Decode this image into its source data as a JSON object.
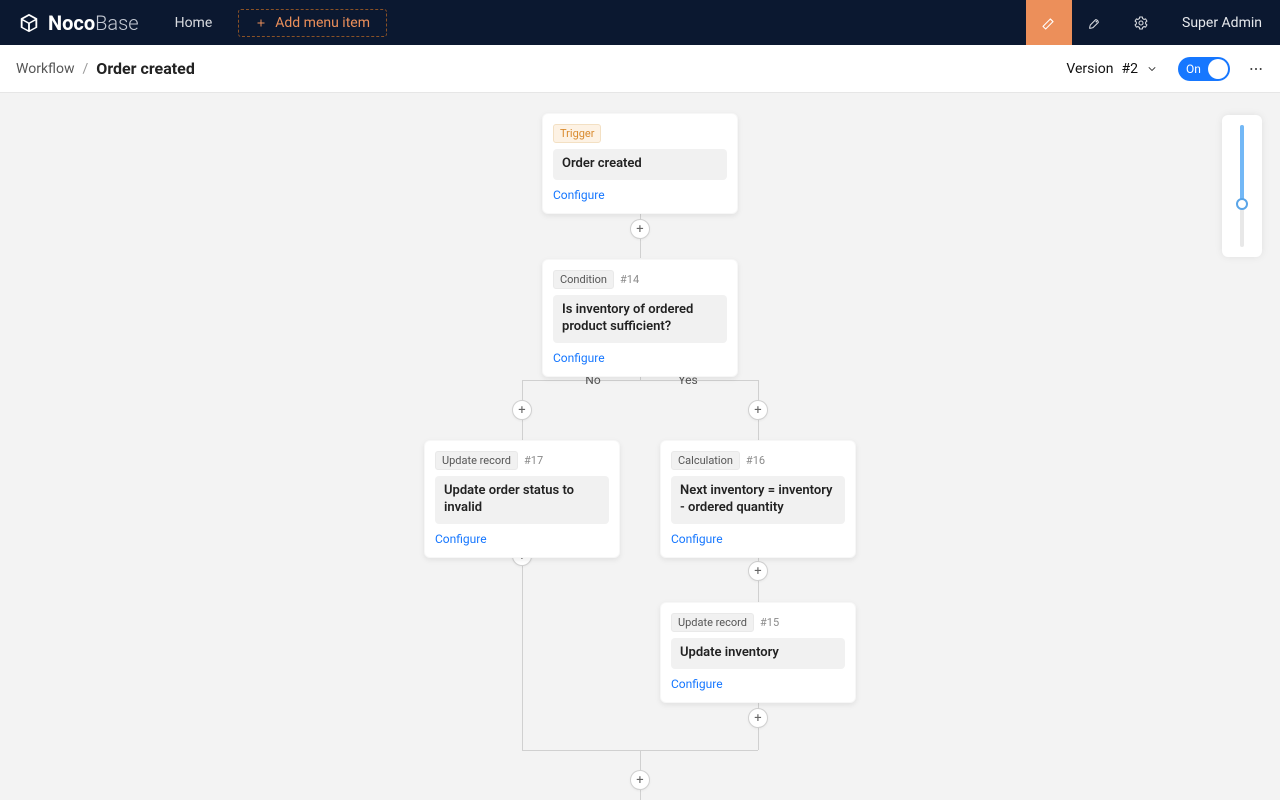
{
  "topbar": {
    "logo_main": "Noco",
    "logo_thin": "Base",
    "home_label": "Home",
    "add_menu_label": "Add menu item",
    "user_label": "Super Admin"
  },
  "subheader": {
    "crumb_workflow": "Workflow",
    "crumb_current": "Order created",
    "version_label": "Version",
    "version_number": "#2",
    "switch_label": "On"
  },
  "branches": {
    "no": "No",
    "yes": "Yes"
  },
  "common": {
    "configure": "Configure"
  },
  "nodes": {
    "trigger": {
      "tag": "Trigger",
      "title": "Order created"
    },
    "condition": {
      "tag": "Condition",
      "hash": "#14",
      "title": "Is inventory of ordered product sufficient?"
    },
    "no_branch": {
      "tag": "Update record",
      "hash": "#17",
      "title": "Update order status to invalid"
    },
    "yes_calc": {
      "tag": "Calculation",
      "hash": "#16",
      "title": "Next inventory = inventory - ordered quantity"
    },
    "yes_update": {
      "tag": "Update record",
      "hash": "#15",
      "title": "Update inventory"
    }
  },
  "zoom": {
    "percent": 65
  }
}
